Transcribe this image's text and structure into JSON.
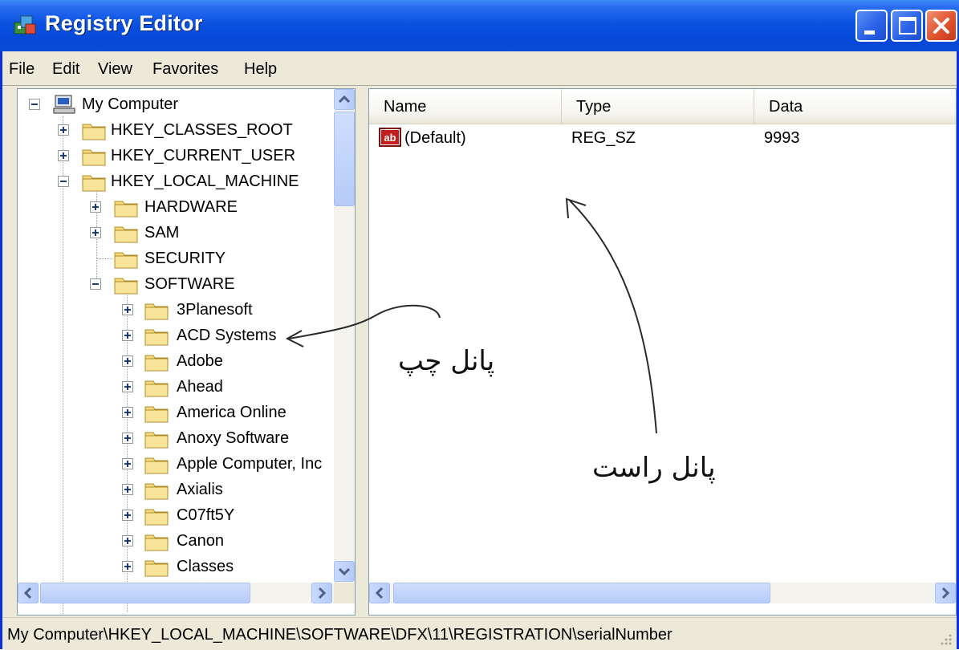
{
  "window": {
    "title": "Registry Editor",
    "icon": "registry-editor-icon"
  },
  "title_buttons": [
    "minimize-icon",
    "maximize-icon",
    "close-icon"
  ],
  "menu": [
    {
      "label": "File"
    },
    {
      "label": "Edit"
    },
    {
      "label": "View"
    },
    {
      "label": "Favorites"
    },
    {
      "label": "Help"
    }
  ],
  "tree": {
    "root": "My Computer",
    "keys": [
      "HKEY_CLASSES_ROOT",
      "HKEY_CURRENT_USER",
      "HKEY_LOCAL_MACHINE",
      "HARDWARE",
      "SAM",
      "SECURITY",
      "SOFTWARE",
      "3Planesoft",
      "ACD Systems",
      "Adobe",
      "Ahead",
      "America Online",
      "Anoxy Software",
      "Apple Computer, Inc",
      "Axialis",
      "C07ft5Y",
      "Canon",
      "Classes"
    ]
  },
  "columns": {
    "name": "Name",
    "type": "Type",
    "data": "Data"
  },
  "values": [
    {
      "name": "(Default)",
      "type": "REG_SZ",
      "data": "9993",
      "icon": "string-value-icon"
    }
  ],
  "status": "My Computer\\HKEY_LOCAL_MACHINE\\SOFTWARE\\DFX\\11\\REGISTRATION\\serialNumber",
  "annotations": {
    "left_panel": "پانل چپ",
    "right_panel": "پانل راست"
  },
  "colors": {
    "titlebar": "#0a52e0",
    "window_bg": "#ece9d8",
    "folder": "#f5dc7a",
    "close_button": "#e0532d"
  }
}
